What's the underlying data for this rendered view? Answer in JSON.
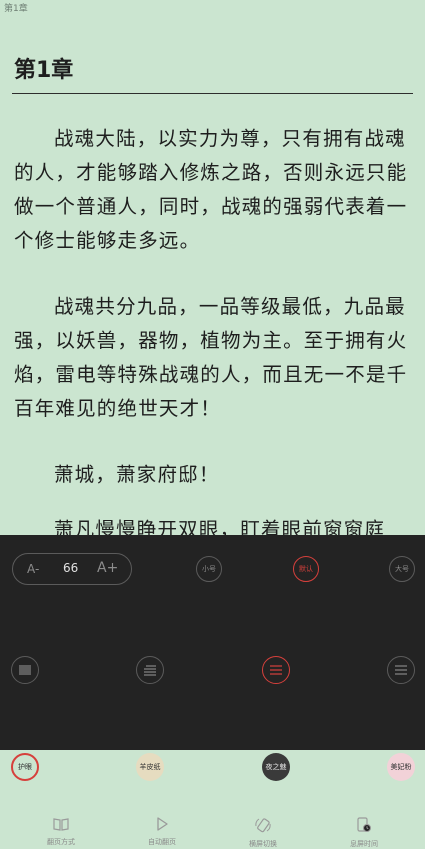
{
  "header": {
    "chapter_label": "第1章"
  },
  "content": {
    "title": "第1章",
    "paragraphs": [
      "战魂大陆，以实力为尊，只有拥有战魂的人，才能够踏入修炼之路，否则永远只能做一个普通人，同时，战魂的强弱代表着一个修士能够走多远。",
      "战魂共分九品，一品等级最低，九品最强，以妖兽，器物，植物为主。至于拥有火焰，雷电等特殊战魂的人，而且无一不是千百年难见的绝世天才！",
      "萧城，萧家府邸！",
      "萧凡慢慢睁开双眼，盯着眼前窗窗庭"
    ]
  },
  "settings": {
    "font_size": {
      "decrease_label": "A-",
      "value": "66",
      "increase_label": "A+"
    },
    "size_presets": [
      {
        "label": "小号",
        "active": false
      },
      {
        "label": "默认",
        "active": true
      },
      {
        "label": "大号",
        "active": false
      }
    ],
    "spacing_options": [
      {
        "name": "compact",
        "active": false
      },
      {
        "name": "normal",
        "active": false
      },
      {
        "name": "loose",
        "active": true
      },
      {
        "name": "extra-loose",
        "active": false
      }
    ],
    "themes": [
      {
        "label": "护眼",
        "color": "#cbe5d0",
        "active": true
      },
      {
        "label": "羊皮纸",
        "color": "#e6dcc0",
        "active": false
      },
      {
        "label": "夜之魅",
        "color": "#3a3a3a",
        "active": false
      },
      {
        "label": "美妃粉",
        "color": "#f2d2d8",
        "active": false
      }
    ]
  },
  "toolbar": {
    "items": [
      {
        "label": "翻页方式",
        "icon": "book-icon"
      },
      {
        "label": "自动翻页",
        "icon": "play-icon"
      },
      {
        "label": "横屏切换",
        "icon": "rotate-icon"
      },
      {
        "label": "息屏时间",
        "icon": "screen-timer-icon"
      }
    ]
  },
  "colors": {
    "accent": "#d6403c",
    "panel_bg": "#232323",
    "page_bg": "#cbe5d0"
  }
}
